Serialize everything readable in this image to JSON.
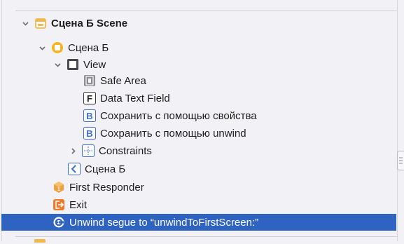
{
  "tree": {
    "scene": {
      "label": "Сцена Б Scene",
      "icon": "storyboard-scene-icon",
      "disclosure": "chevron-down-icon"
    },
    "controller": {
      "label": "Сцена Б",
      "icon": "view-controller-icon",
      "disclosure": "chevron-down-icon"
    },
    "view": {
      "label": "View",
      "icon": "view-icon",
      "disclosure": "chevron-down-icon"
    },
    "safe_area": {
      "label": "Safe Area",
      "icon": "safe-area-icon"
    },
    "text_field": {
      "label": "Data Text Field",
      "icon": "text-field-icon",
      "icon_letter": "F"
    },
    "button_1": {
      "label": "Сохранить с помощью свойства",
      "icon": "button-icon",
      "icon_letter": "B"
    },
    "button_2": {
      "label": "Сохранить с помощью unwind",
      "icon": "button-icon",
      "icon_letter": "B"
    },
    "constraints": {
      "label": "Constraints",
      "icon": "constraints-icon",
      "disclosure": "chevron-right-icon"
    },
    "back_item": {
      "label": "Сцена Б",
      "icon": "back-chevron-icon",
      "icon_glyph": "<"
    },
    "first_responder": {
      "label": "First Responder",
      "icon": "first-responder-icon"
    },
    "exit": {
      "label": "Exit",
      "icon": "exit-icon"
    },
    "unwind": {
      "label": "Unwind segue to “unwindToFirstScreen:”",
      "icon": "unwind-segue-icon"
    }
  },
  "colors": {
    "selection": "#2e63c2",
    "scene_icon": "#f2b94a",
    "controller_icon": "#f6b31b",
    "button_icon": "#3b6fd8",
    "first_responder": "#f0a03c",
    "exit": "#f07a2c"
  }
}
